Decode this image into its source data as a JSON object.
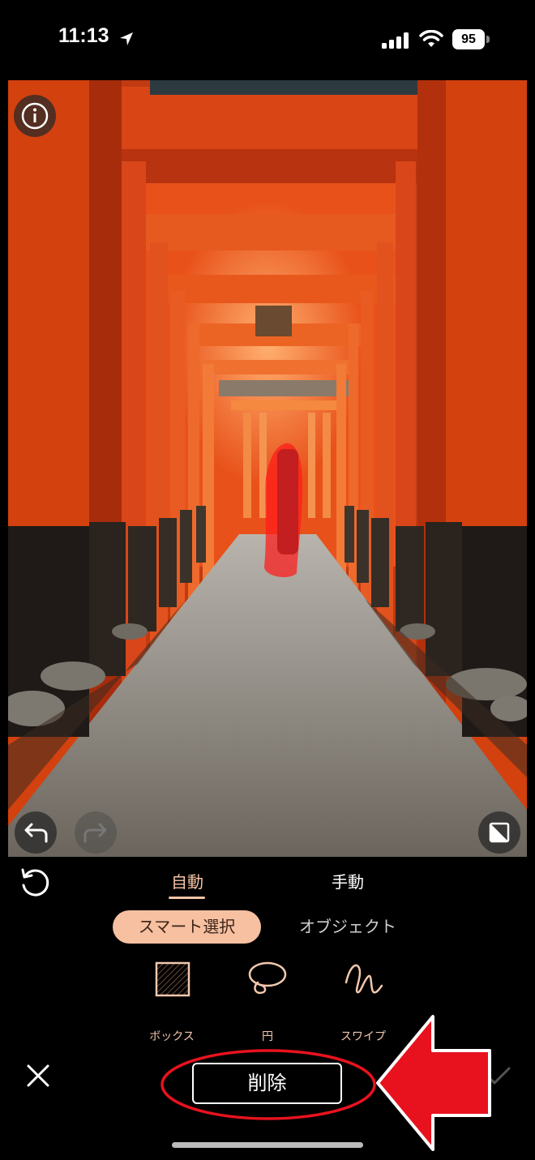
{
  "status_bar": {
    "time": "11:13",
    "battery": "95"
  },
  "editor": {
    "tabs": [
      {
        "label": "自動",
        "active": true
      },
      {
        "label": "手動",
        "active": false
      }
    ],
    "modes": [
      {
        "label": "スマート選択",
        "active": true
      },
      {
        "label": "オブジェクト",
        "active": false
      }
    ],
    "tools": [
      {
        "label": "ボックス",
        "icon": "box-hatched-icon"
      },
      {
        "label": "円",
        "icon": "lasso-circle-icon"
      },
      {
        "label": "スワイプ",
        "icon": "swipe-squiggle-icon"
      }
    ],
    "delete_label": "削除"
  },
  "colors": {
    "accent": "#f7c0a0",
    "selection_overlay": "#ff1a1a",
    "annotation_red": "#e8121e",
    "torii_orange": "#e8521a"
  },
  "icons": [
    "info-icon",
    "undo-icon",
    "redo-icon",
    "compare-icon",
    "reset-icon",
    "close-icon",
    "checkmark-icon"
  ]
}
